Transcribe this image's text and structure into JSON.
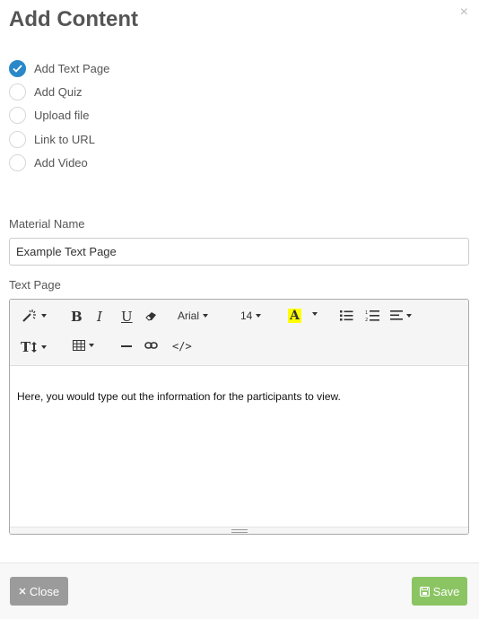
{
  "modal": {
    "title": "Add Content",
    "close_symbol": "×"
  },
  "options": [
    {
      "label": "Add Text Page",
      "checked": true
    },
    {
      "label": "Add Quiz",
      "checked": false
    },
    {
      "label": "Upload file",
      "checked": false
    },
    {
      "label": "Link to URL",
      "checked": false
    },
    {
      "label": "Add Video",
      "checked": false
    }
  ],
  "material_name": {
    "label": "Material Name",
    "value": "Example Text Page"
  },
  "text_page": {
    "label": "Text Page",
    "toolbar": {
      "font_family": "Arial",
      "font_size": "14",
      "code_label": "</>",
      "icons": [
        "magic-wand-icon",
        "bold-icon",
        "italic-icon",
        "underline-icon",
        "eraser-icon",
        "font-color-icon",
        "bullet-list-icon",
        "numbered-list-icon",
        "align-icon",
        "text-height-icon",
        "table-icon",
        "horizontal-rule-icon",
        "link-icon",
        "code-view-icon"
      ]
    },
    "content": "Here, you would type out the information for the participants to view."
  },
  "footer": {
    "close_label": "Close",
    "save_label": "Save"
  },
  "colors": {
    "checked_radio": "#2a88c8",
    "close_button": "#9b9b9b",
    "save_button": "#8bc563",
    "highlight": "#ffff00"
  }
}
